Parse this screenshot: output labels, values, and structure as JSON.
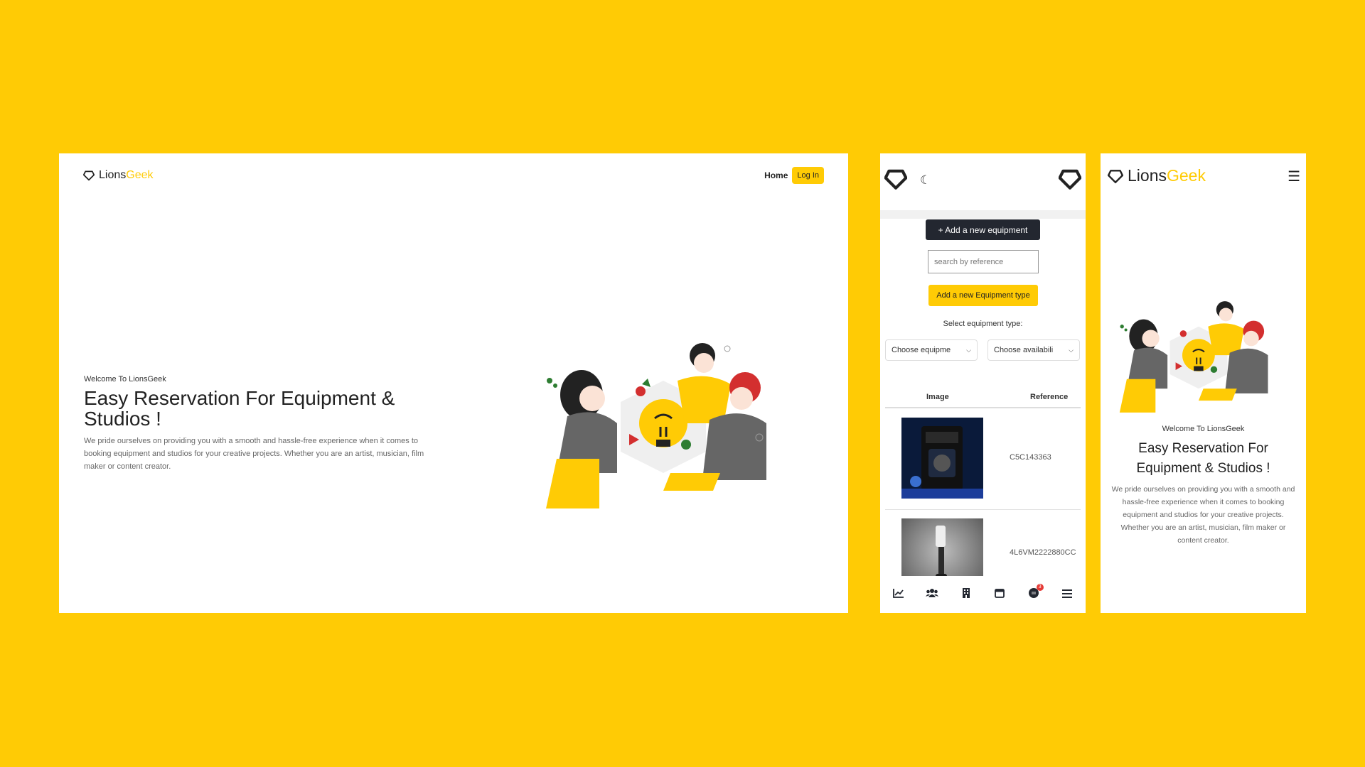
{
  "brand": {
    "part1": "Lions",
    "part2": "Geek"
  },
  "colors": {
    "background": "#FFCB05",
    "accent": "#FFCB05",
    "dark": "#232730"
  },
  "desktop": {
    "nav": {
      "home": "Home",
      "login": "Log In"
    },
    "hero": {
      "kicker": "Welcome To LionsGeek",
      "title": "Easy Reservation For Equipment & Studios !",
      "description": "We pride ourselves on providing you with a smooth and hassle-free experience when it comes to booking equipment and studios for your creative projects. Whether you are an artist, musician, film maker or content creator."
    }
  },
  "admin": {
    "moon_icon": "☾",
    "add_equipment": "+ Add a new equipment",
    "search_placeholder": "search by reference",
    "add_type": "Add a new Equipment type",
    "select_label": "Select equipment type:",
    "type_select": "Choose equipme",
    "avail_select": "Choose availabili",
    "table": {
      "headers": {
        "image": "Image",
        "reference": "Reference"
      },
      "rows": [
        {
          "image": "audio-recorder-photo",
          "reference": "C5C143363"
        },
        {
          "image": "phone-gimbal-photo",
          "reference": "4L6VM2222880CC"
        }
      ]
    },
    "bottom_nav": [
      {
        "icon": "chart-line-icon",
        "glyph": "📈"
      },
      {
        "icon": "users-icon",
        "glyph": "👥"
      },
      {
        "icon": "building-icon",
        "glyph": "▦"
      },
      {
        "icon": "calendar-icon",
        "glyph": "▭"
      },
      {
        "icon": "notification-icon",
        "glyph": "●",
        "badge": "3"
      },
      {
        "icon": "menu-icon",
        "glyph": "☰"
      }
    ]
  },
  "mobile_home": {
    "menu_icon": "☰",
    "kicker": "Welcome To LionsGeek",
    "title": "Easy Reservation For Equipment & Studios !",
    "description": "We pride ourselves on providing you with a smooth and hassle-free experience when it comes to booking equipment and studios for your creative projects. Whether you are an artist, musician, film maker or content creator."
  }
}
